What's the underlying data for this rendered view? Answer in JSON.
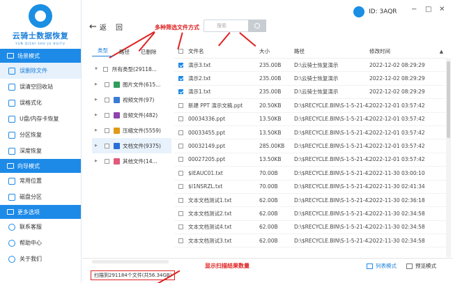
{
  "app": {
    "title": "云骑士数据恢复",
    "subtitle": "YUN QISHI SHU JU HUIFU",
    "user_id": "ID: 3AQR",
    "win_min": "−",
    "win_max": "□",
    "win_close": "✕"
  },
  "sidebar": {
    "sections": [
      {
        "title": "场景模式",
        "items": [
          "误删除文件",
          "误清空回收站",
          "误格式化",
          "U盘/内存卡恢复",
          "分区恢复",
          "深度恢复"
        ]
      },
      {
        "title": "向导模式",
        "items": [
          "常用位置",
          "磁盘分区"
        ]
      },
      {
        "title": "更多选项",
        "items": [
          "联系客服",
          "帮助中心",
          "关于我们"
        ]
      }
    ]
  },
  "toolbar": {
    "back_label": "返",
    "back_arrow": "←",
    "home_label": "回",
    "search_placeholder": "搜索"
  },
  "annotations": {
    "filter_methods": "多种筛选文件方式",
    "scan_result": "显示扫描结果数量"
  },
  "filter": {
    "tabs": [
      "类型",
      "路径",
      "已删除"
    ],
    "tree": [
      {
        "label": "所有类型(29118...",
        "expand": "▼",
        "indent": 0,
        "color": "",
        "selected": false
      },
      {
        "label": "图片文件(615...",
        "expand": "▶",
        "indent": 1,
        "color": "#2e9e5b",
        "selected": false
      },
      {
        "label": "视频文件(97)",
        "expand": "▶",
        "indent": 1,
        "color": "#3a7bd5",
        "selected": false
      },
      {
        "label": "音频文件(482)",
        "expand": "▶",
        "indent": 1,
        "color": "#8e44ad",
        "selected": false
      },
      {
        "label": "压缩文件(5559)",
        "expand": "▶",
        "indent": 1,
        "color": "#e09a1a",
        "selected": false
      },
      {
        "label": "文档文件(9375)",
        "expand": "▶",
        "indent": 1,
        "color": "#2b6fd6",
        "selected": true
      },
      {
        "label": "其他文件(14...",
        "expand": "▶",
        "indent": 1,
        "color": "#e05a7a",
        "selected": false
      }
    ]
  },
  "table": {
    "columns": [
      "文件名",
      "大小",
      "路径",
      "修改时间"
    ],
    "sort_indicator": "▲",
    "rows": [
      {
        "checked": true,
        "name": "演示3.txt",
        "size": "235.00B",
        "path": "D:\\云骑士恢复演示",
        "time": "2022-12-02 08:29:29"
      },
      {
        "checked": true,
        "name": "演示2.txt",
        "size": "235.00B",
        "path": "D:\\云骑士恢复演示",
        "time": "2022-12-02 08:29:29"
      },
      {
        "checked": true,
        "name": "演示1.txt",
        "size": "235.00B",
        "path": "D:\\云骑士恢复演示",
        "time": "2022-12-02 08:29:29"
      },
      {
        "checked": false,
        "name": "新建 PPT 演示文稿.ppt",
        "size": "20.50KB",
        "path": "D:\\$RECYCLE.BIN\\S-1-5-21-4200...",
        "time": "2022-12-01 03:57:42"
      },
      {
        "checked": false,
        "name": "00034336.ppt",
        "size": "13.50KB",
        "path": "D:\\$RECYCLE.BIN\\S-1-5-21-4200...",
        "time": "2022-12-01 03:57:42"
      },
      {
        "checked": false,
        "name": "00033455.ppt",
        "size": "13.50KB",
        "path": "D:\\$RECYCLE.BIN\\S-1-5-21-4200...",
        "time": "2022-12-01 03:57:42"
      },
      {
        "checked": false,
        "name": "00032149.ppt",
        "size": "285.00KB",
        "path": "D:\\$RECYCLE.BIN\\S-1-5-21-4200...",
        "time": "2022-12-01 03:57:42"
      },
      {
        "checked": false,
        "name": "00027205.ppt",
        "size": "13.50KB",
        "path": "D:\\$RECYCLE.BIN\\S-1-5-21-4200...",
        "time": "2022-12-01 03:57:42"
      },
      {
        "checked": false,
        "name": "$IEAUC01.txt",
        "size": "70.00B",
        "path": "D:\\$RECYCLE.BIN\\S-1-5-21-4200...",
        "time": "2022-11-30 03:00:10"
      },
      {
        "checked": false,
        "name": "$I1NSRZL.txt",
        "size": "70.00B",
        "path": "D:\\$RECYCLE.BIN\\S-1-5-21-4200...",
        "time": "2022-11-30 02:41:34"
      },
      {
        "checked": false,
        "name": "文本文档测试1.txt",
        "size": "62.00B",
        "path": "D:\\$RECYCLE.BIN\\S-1-5-21-4200...",
        "time": "2022-11-30 02:36:18"
      },
      {
        "checked": false,
        "name": "文本文档测试2.txt",
        "size": "62.00B",
        "path": "D:\\$RECYCLE.BIN\\S-1-5-21-4200...",
        "time": "2022-11-30 02:34:58"
      },
      {
        "checked": false,
        "name": "文本文档测试4.txt",
        "size": "62.00B",
        "path": "D:\\$RECYCLE.BIN\\S-1-5-21-4200...",
        "time": "2022-11-30 02:34:58"
      },
      {
        "checked": false,
        "name": "文本文档测试3.txt",
        "size": "62.00B",
        "path": "D:\\$RECYCLE.BIN\\S-1-5-21-4200...",
        "time": "2022-11-30 02:34:58"
      }
    ]
  },
  "footer": {
    "scan_status": "扫描到291184个文件(共56.34GB)",
    "list_mode": "列表模式",
    "preview_mode": "预览模式"
  },
  "colors": {
    "accent": "#1d8ae8",
    "annotation": "#e02020"
  }
}
